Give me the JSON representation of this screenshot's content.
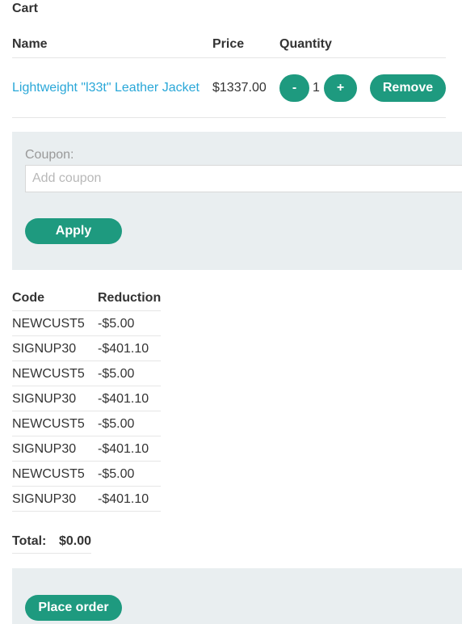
{
  "cart": {
    "title": "Cart",
    "headers": {
      "name": "Name",
      "price": "Price",
      "quantity": "Quantity"
    },
    "items": [
      {
        "name": "Lightweight \"l33t\" Leather Jacket",
        "price": "$1337.00",
        "quantity": "1",
        "minus_label": "-",
        "plus_label": "+",
        "remove_label": "Remove"
      }
    ]
  },
  "coupon": {
    "label": "Coupon:",
    "placeholder": "Add coupon",
    "value": "",
    "apply_label": "Apply"
  },
  "codes": {
    "headers": {
      "code": "Code",
      "reduction": "Reduction"
    },
    "rows": [
      {
        "code": "NEWCUST5",
        "reduction": "-$5.00"
      },
      {
        "code": "SIGNUP30",
        "reduction": "-$401.10"
      },
      {
        "code": "NEWCUST5",
        "reduction": "-$5.00"
      },
      {
        "code": "SIGNUP30",
        "reduction": "-$401.10"
      },
      {
        "code": "NEWCUST5",
        "reduction": "-$5.00"
      },
      {
        "code": "SIGNUP30",
        "reduction": "-$401.10"
      },
      {
        "code": "NEWCUST5",
        "reduction": "-$5.00"
      },
      {
        "code": "SIGNUP30",
        "reduction": "-$401.10"
      }
    ]
  },
  "total": {
    "label": "Total:",
    "value": "$0.00"
  },
  "order": {
    "place_label": "Place order"
  },
  "colors": {
    "accent": "#1e9a7f",
    "link": "#29a7d8",
    "panel": "#e9eef0"
  }
}
